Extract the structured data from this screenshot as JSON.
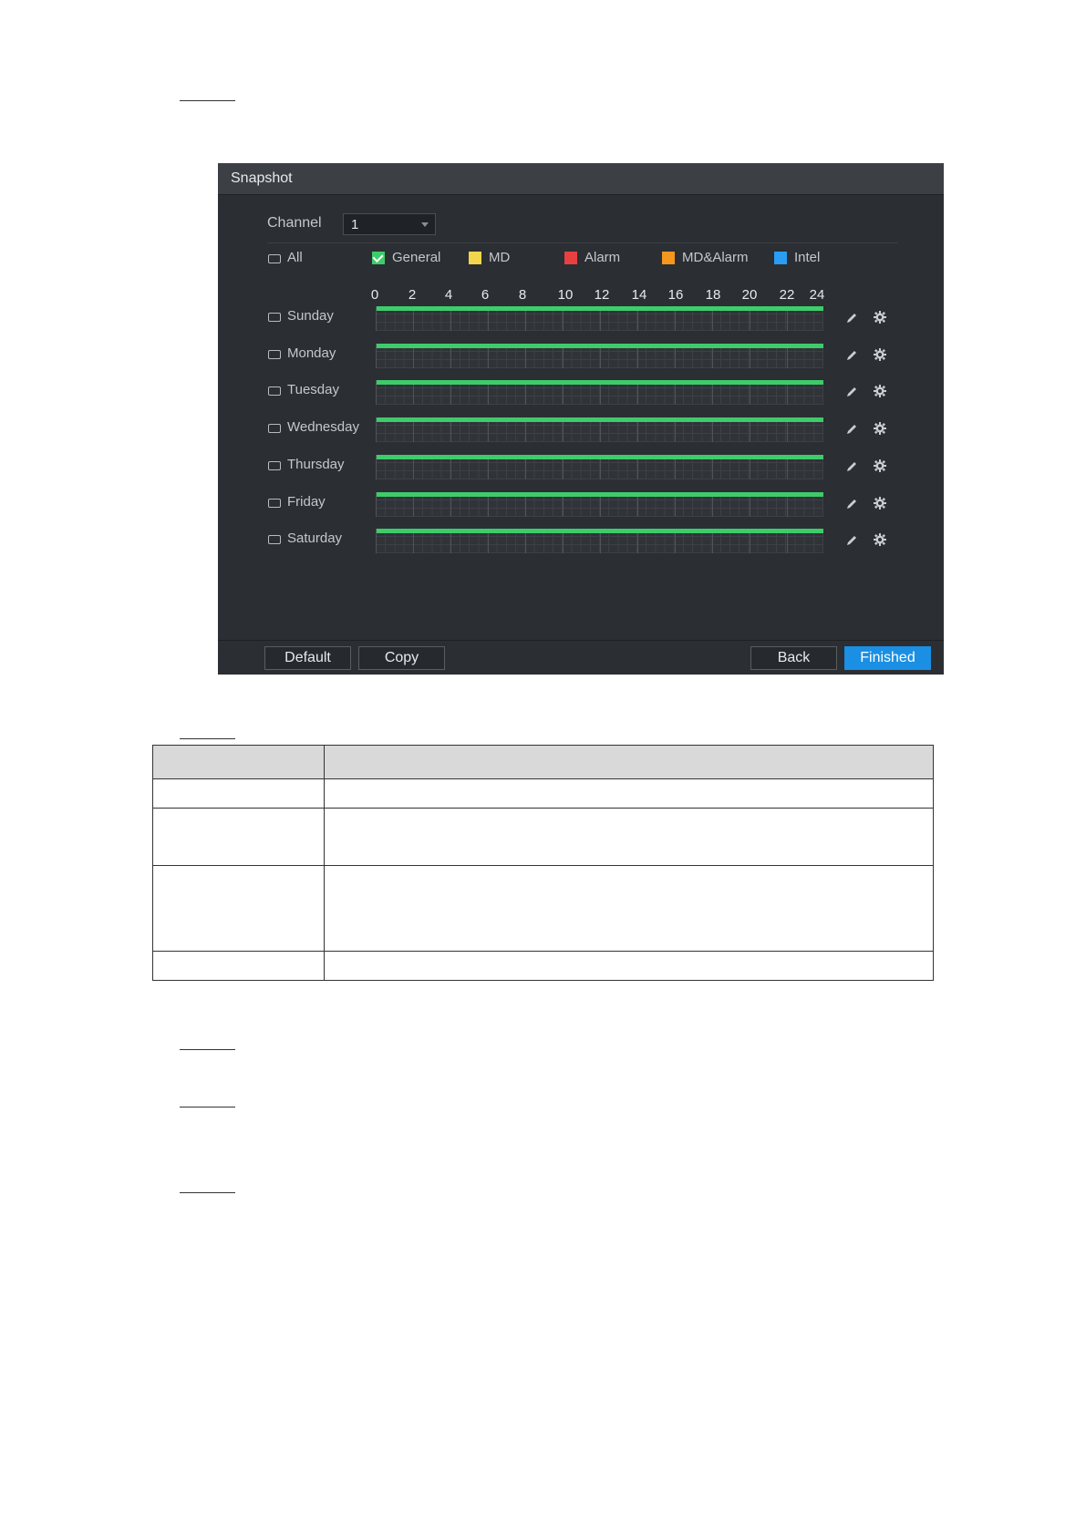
{
  "dialog": {
    "title": "Snapshot",
    "channel_label": "Channel",
    "channel_value": "1",
    "all_label": "All",
    "legend": [
      {
        "label": "General",
        "color": "#3ecc6a",
        "checked": true
      },
      {
        "label": "MD",
        "color": "#f2d54b",
        "checked": false
      },
      {
        "label": "Alarm",
        "color": "#e84040",
        "checked": false
      },
      {
        "label": "MD&Alarm",
        "color": "#f5961e",
        "checked": false
      },
      {
        "label": "Intel",
        "color": "#2a9df4",
        "checked": false
      }
    ],
    "hours": [
      "0",
      "2",
      "4",
      "6",
      "8",
      "10",
      "12",
      "14",
      "16",
      "18",
      "20",
      "22",
      "24"
    ],
    "days": [
      {
        "label": "Sunday",
        "schedule": [
          {
            "type": "General",
            "start": 0,
            "end": 24
          }
        ]
      },
      {
        "label": "Monday",
        "schedule": [
          {
            "type": "General",
            "start": 0,
            "end": 24
          }
        ]
      },
      {
        "label": "Tuesday",
        "schedule": [
          {
            "type": "General",
            "start": 0,
            "end": 24
          }
        ]
      },
      {
        "label": "Wednesday",
        "schedule": [
          {
            "type": "General",
            "start": 0,
            "end": 24
          }
        ]
      },
      {
        "label": "Thursday",
        "schedule": [
          {
            "type": "General",
            "start": 0,
            "end": 24
          }
        ]
      },
      {
        "label": "Friday",
        "schedule": [
          {
            "type": "General",
            "start": 0,
            "end": 24
          }
        ]
      },
      {
        "label": "Saturday",
        "schedule": [
          {
            "type": "General",
            "start": 0,
            "end": 24
          }
        ]
      }
    ],
    "buttons": {
      "default": "Default",
      "copy": "Copy",
      "back": "Back",
      "finished": "Finished"
    },
    "colors": {
      "accent": "#1a8fe3",
      "general": "#3ecc6a",
      "background": "#2b2e33"
    },
    "icons": {
      "row_edit": "pencil-icon",
      "row_settings": "gear-icon",
      "dropdown": "chevron-down-icon"
    }
  }
}
